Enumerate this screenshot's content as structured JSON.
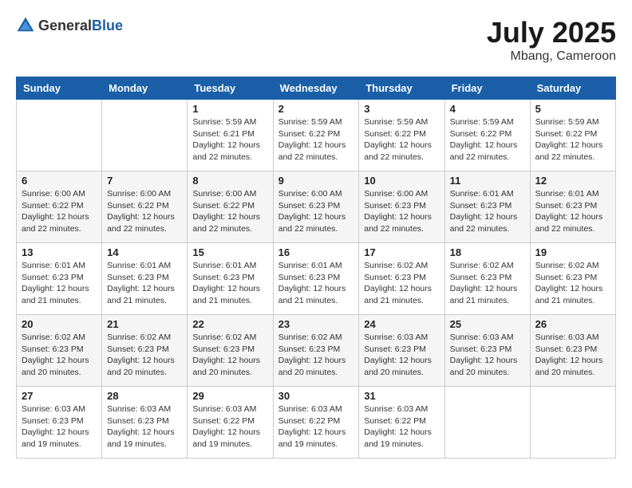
{
  "header": {
    "logo_general": "General",
    "logo_blue": "Blue",
    "month_title": "July 2025",
    "location": "Mbang, Cameroon"
  },
  "weekdays": [
    "Sunday",
    "Monday",
    "Tuesday",
    "Wednesday",
    "Thursday",
    "Friday",
    "Saturday"
  ],
  "weeks": [
    [
      {
        "day": "",
        "sunrise": "",
        "sunset": "",
        "daylight": ""
      },
      {
        "day": "",
        "sunrise": "",
        "sunset": "",
        "daylight": ""
      },
      {
        "day": "1",
        "sunrise": "Sunrise: 5:59 AM",
        "sunset": "Sunset: 6:21 PM",
        "daylight": "Daylight: 12 hours and 22 minutes."
      },
      {
        "day": "2",
        "sunrise": "Sunrise: 5:59 AM",
        "sunset": "Sunset: 6:22 PM",
        "daylight": "Daylight: 12 hours and 22 minutes."
      },
      {
        "day": "3",
        "sunrise": "Sunrise: 5:59 AM",
        "sunset": "Sunset: 6:22 PM",
        "daylight": "Daylight: 12 hours and 22 minutes."
      },
      {
        "day": "4",
        "sunrise": "Sunrise: 5:59 AM",
        "sunset": "Sunset: 6:22 PM",
        "daylight": "Daylight: 12 hours and 22 minutes."
      },
      {
        "day": "5",
        "sunrise": "Sunrise: 5:59 AM",
        "sunset": "Sunset: 6:22 PM",
        "daylight": "Daylight: 12 hours and 22 minutes."
      }
    ],
    [
      {
        "day": "6",
        "sunrise": "Sunrise: 6:00 AM",
        "sunset": "Sunset: 6:22 PM",
        "daylight": "Daylight: 12 hours and 22 minutes."
      },
      {
        "day": "7",
        "sunrise": "Sunrise: 6:00 AM",
        "sunset": "Sunset: 6:22 PM",
        "daylight": "Daylight: 12 hours and 22 minutes."
      },
      {
        "day": "8",
        "sunrise": "Sunrise: 6:00 AM",
        "sunset": "Sunset: 6:22 PM",
        "daylight": "Daylight: 12 hours and 22 minutes."
      },
      {
        "day": "9",
        "sunrise": "Sunrise: 6:00 AM",
        "sunset": "Sunset: 6:23 PM",
        "daylight": "Daylight: 12 hours and 22 minutes."
      },
      {
        "day": "10",
        "sunrise": "Sunrise: 6:00 AM",
        "sunset": "Sunset: 6:23 PM",
        "daylight": "Daylight: 12 hours and 22 minutes."
      },
      {
        "day": "11",
        "sunrise": "Sunrise: 6:01 AM",
        "sunset": "Sunset: 6:23 PM",
        "daylight": "Daylight: 12 hours and 22 minutes."
      },
      {
        "day": "12",
        "sunrise": "Sunrise: 6:01 AM",
        "sunset": "Sunset: 6:23 PM",
        "daylight": "Daylight: 12 hours and 22 minutes."
      }
    ],
    [
      {
        "day": "13",
        "sunrise": "Sunrise: 6:01 AM",
        "sunset": "Sunset: 6:23 PM",
        "daylight": "Daylight: 12 hours and 21 minutes."
      },
      {
        "day": "14",
        "sunrise": "Sunrise: 6:01 AM",
        "sunset": "Sunset: 6:23 PM",
        "daylight": "Daylight: 12 hours and 21 minutes."
      },
      {
        "day": "15",
        "sunrise": "Sunrise: 6:01 AM",
        "sunset": "Sunset: 6:23 PM",
        "daylight": "Daylight: 12 hours and 21 minutes."
      },
      {
        "day": "16",
        "sunrise": "Sunrise: 6:01 AM",
        "sunset": "Sunset: 6:23 PM",
        "daylight": "Daylight: 12 hours and 21 minutes."
      },
      {
        "day": "17",
        "sunrise": "Sunrise: 6:02 AM",
        "sunset": "Sunset: 6:23 PM",
        "daylight": "Daylight: 12 hours and 21 minutes."
      },
      {
        "day": "18",
        "sunrise": "Sunrise: 6:02 AM",
        "sunset": "Sunset: 6:23 PM",
        "daylight": "Daylight: 12 hours and 21 minutes."
      },
      {
        "day": "19",
        "sunrise": "Sunrise: 6:02 AM",
        "sunset": "Sunset: 6:23 PM",
        "daylight": "Daylight: 12 hours and 21 minutes."
      }
    ],
    [
      {
        "day": "20",
        "sunrise": "Sunrise: 6:02 AM",
        "sunset": "Sunset: 6:23 PM",
        "daylight": "Daylight: 12 hours and 20 minutes."
      },
      {
        "day": "21",
        "sunrise": "Sunrise: 6:02 AM",
        "sunset": "Sunset: 6:23 PM",
        "daylight": "Daylight: 12 hours and 20 minutes."
      },
      {
        "day": "22",
        "sunrise": "Sunrise: 6:02 AM",
        "sunset": "Sunset: 6:23 PM",
        "daylight": "Daylight: 12 hours and 20 minutes."
      },
      {
        "day": "23",
        "sunrise": "Sunrise: 6:02 AM",
        "sunset": "Sunset: 6:23 PM",
        "daylight": "Daylight: 12 hours and 20 minutes."
      },
      {
        "day": "24",
        "sunrise": "Sunrise: 6:03 AM",
        "sunset": "Sunset: 6:23 PM",
        "daylight": "Daylight: 12 hours and 20 minutes."
      },
      {
        "day": "25",
        "sunrise": "Sunrise: 6:03 AM",
        "sunset": "Sunset: 6:23 PM",
        "daylight": "Daylight: 12 hours and 20 minutes."
      },
      {
        "day": "26",
        "sunrise": "Sunrise: 6:03 AM",
        "sunset": "Sunset: 6:23 PM",
        "daylight": "Daylight: 12 hours and 20 minutes."
      }
    ],
    [
      {
        "day": "27",
        "sunrise": "Sunrise: 6:03 AM",
        "sunset": "Sunset: 6:23 PM",
        "daylight": "Daylight: 12 hours and 19 minutes."
      },
      {
        "day": "28",
        "sunrise": "Sunrise: 6:03 AM",
        "sunset": "Sunset: 6:23 PM",
        "daylight": "Daylight: 12 hours and 19 minutes."
      },
      {
        "day": "29",
        "sunrise": "Sunrise: 6:03 AM",
        "sunset": "Sunset: 6:22 PM",
        "daylight": "Daylight: 12 hours and 19 minutes."
      },
      {
        "day": "30",
        "sunrise": "Sunrise: 6:03 AM",
        "sunset": "Sunset: 6:22 PM",
        "daylight": "Daylight: 12 hours and 19 minutes."
      },
      {
        "day": "31",
        "sunrise": "Sunrise: 6:03 AM",
        "sunset": "Sunset: 6:22 PM",
        "daylight": "Daylight: 12 hours and 19 minutes."
      },
      {
        "day": "",
        "sunrise": "",
        "sunset": "",
        "daylight": ""
      },
      {
        "day": "",
        "sunrise": "",
        "sunset": "",
        "daylight": ""
      }
    ]
  ]
}
